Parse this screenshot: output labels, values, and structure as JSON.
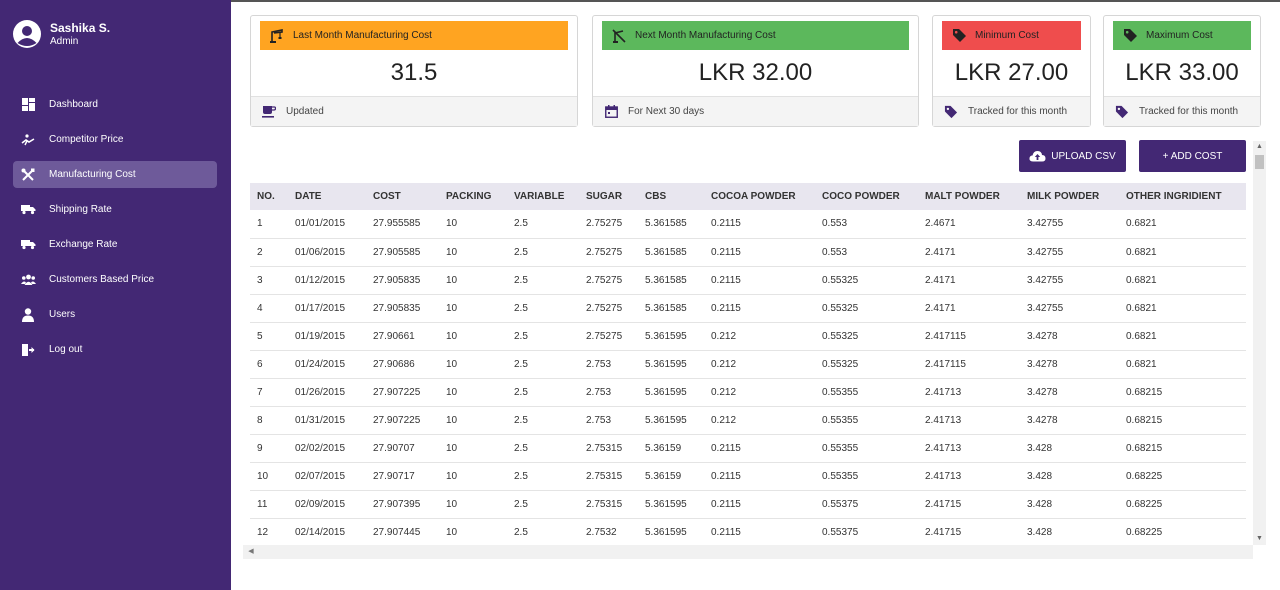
{
  "user": {
    "name": "Sashika S.",
    "role": "Admin"
  },
  "nav": [
    {
      "label": "Dashboard",
      "icon": "dashboard-icon",
      "active": false
    },
    {
      "label": "Competitor Price",
      "icon": "runner-icon",
      "active": false
    },
    {
      "label": "Manufacturing Cost",
      "icon": "tools-icon",
      "active": true
    },
    {
      "label": "Shipping Rate",
      "icon": "truck-icon",
      "active": false
    },
    {
      "label": "Exchange Rate",
      "icon": "truck-icon",
      "active": false
    },
    {
      "label": "Customers Based Price",
      "icon": "users-icon",
      "active": false
    },
    {
      "label": "Users",
      "icon": "user-icon",
      "active": false
    },
    {
      "label": "Log out",
      "icon": "logout-icon",
      "active": false
    }
  ],
  "cards": [
    {
      "title": "Last Month Manufacturing Cost",
      "value": "31.5",
      "footer": "Updated",
      "color": "#ffa421",
      "head_icon": "crane-icon",
      "foot_icon": "coffee-icon"
    },
    {
      "title": "Next Month Manufacturing Cost",
      "value": "LKR 32.00",
      "footer": "For Next 30 days",
      "color": "#5cb85c",
      "head_icon": "crane-off-icon",
      "foot_icon": "calendar-icon"
    },
    {
      "title": "Minimum Cost",
      "value": "LKR 27.00",
      "footer": "Tracked for this month",
      "color": "#ef4d4d",
      "head_icon": "tag-icon",
      "foot_icon": "tag-icon"
    },
    {
      "title": "Maximum Cost",
      "value": "LKR 33.00",
      "footer": "Tracked for this month",
      "color": "#5cb85c",
      "head_icon": "tag-icon",
      "foot_icon": "tag-icon"
    }
  ],
  "buttons": {
    "upload": "UPLOAD CSV",
    "add": "+ ADD COST"
  },
  "table": {
    "columns": [
      "NO.",
      "DATE",
      "COST",
      "PACKING",
      "VARIABLE",
      "SUGAR",
      "CBS",
      "COCOA POWDER",
      "COCO POWDER",
      "MALT POWDER",
      "MILK POWDER",
      "OTHER INGRIDIENT"
    ],
    "rows": [
      [
        "1",
        "01/01/2015",
        "27.955585",
        "10",
        "2.5",
        "2.75275",
        "5.361585",
        "0.2115",
        "0.553",
        "2.4671",
        "3.42755",
        "0.6821"
      ],
      [
        "2",
        "01/06/2015",
        "27.905585",
        "10",
        "2.5",
        "2.75275",
        "5.361585",
        "0.2115",
        "0.553",
        "2.4171",
        "3.42755",
        "0.6821"
      ],
      [
        "3",
        "01/12/2015",
        "27.905835",
        "10",
        "2.5",
        "2.75275",
        "5.361585",
        "0.2115",
        "0.55325",
        "2.4171",
        "3.42755",
        "0.6821"
      ],
      [
        "4",
        "01/17/2015",
        "27.905835",
        "10",
        "2.5",
        "2.75275",
        "5.361585",
        "0.2115",
        "0.55325",
        "2.4171",
        "3.42755",
        "0.6821"
      ],
      [
        "5",
        "01/19/2015",
        "27.90661",
        "10",
        "2.5",
        "2.75275",
        "5.361595",
        "0.212",
        "0.55325",
        "2.417115",
        "3.4278",
        "0.6821"
      ],
      [
        "6",
        "01/24/2015",
        "27.90686",
        "10",
        "2.5",
        "2.753",
        "5.361595",
        "0.212",
        "0.55325",
        "2.417115",
        "3.4278",
        "0.6821"
      ],
      [
        "7",
        "01/26/2015",
        "27.907225",
        "10",
        "2.5",
        "2.753",
        "5.361595",
        "0.212",
        "0.55355",
        "2.41713",
        "3.4278",
        "0.68215"
      ],
      [
        "8",
        "01/31/2015",
        "27.907225",
        "10",
        "2.5",
        "2.753",
        "5.361595",
        "0.212",
        "0.55355",
        "2.41713",
        "3.4278",
        "0.68215"
      ],
      [
        "9",
        "02/02/2015",
        "27.90707",
        "10",
        "2.5",
        "2.75315",
        "5.36159",
        "0.2115",
        "0.55355",
        "2.41713",
        "3.428",
        "0.68215"
      ],
      [
        "10",
        "02/07/2015",
        "27.90717",
        "10",
        "2.5",
        "2.75315",
        "5.36159",
        "0.2115",
        "0.55355",
        "2.41713",
        "3.428",
        "0.68225"
      ],
      [
        "11",
        "02/09/2015",
        "27.907395",
        "10",
        "2.5",
        "2.75315",
        "5.361595",
        "0.2115",
        "0.55375",
        "2.41715",
        "3.428",
        "0.68225"
      ],
      [
        "12",
        "02/14/2015",
        "27.907445",
        "10",
        "2.5",
        "2.7532",
        "5.361595",
        "0.2115",
        "0.55375",
        "2.41715",
        "3.428",
        "0.68225"
      ]
    ]
  },
  "colors": {
    "sidebar": "#432874",
    "active_nav": "#6e5a9a",
    "header_row": "#e8e6ef"
  }
}
